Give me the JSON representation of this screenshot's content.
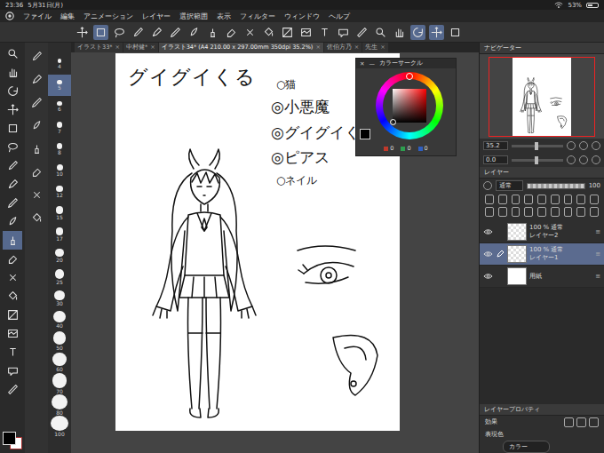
{
  "status_bar": {
    "time": "23:36",
    "date": "5月31日(月)",
    "battery": "53%",
    "battery_level": 0.53
  },
  "menu": [
    "ファイル",
    "編集",
    "アニメーション",
    "レイヤー",
    "選択範囲",
    "表示",
    "フィルター",
    "ウィンドウ",
    "ヘルプ"
  ],
  "command_bar": [
    {
      "selected": false
    },
    {
      "selected": true
    },
    {
      "selected": false
    },
    {
      "selected": false
    },
    {
      "selected": false
    },
    {
      "selected": false
    },
    {
      "selected": false
    },
    {
      "selected": false
    },
    {
      "selected": false
    },
    {
      "selected": false
    },
    {
      "selected": false
    },
    {
      "selected": false
    },
    {
      "selected": false
    },
    {
      "selected": false
    },
    {
      "selected": false
    },
    {
      "selected": false
    },
    {
      "selected": false
    },
    {
      "selected": false
    },
    {
      "selected": true
    },
    {
      "selected": true
    },
    {
      "selected": false
    }
  ],
  "tabs": [
    {
      "label": "イラスト33*",
      "selected": false
    },
    {
      "label": "中村健*",
      "selected": false
    },
    {
      "label": "イラスト34* (A4 210.00 x 297.00mm 350dpi 35.2%)",
      "selected": true
    },
    {
      "label": "佐伯方乃",
      "selected": false
    },
    {
      "label": "先生",
      "selected": false
    }
  ],
  "tab_close": "×",
  "tools": [
    {
      "selected": false
    },
    {
      "selected": false
    },
    {
      "selected": false
    },
    {
      "selected": false
    },
    {
      "selected": false
    },
    {
      "selected": false
    },
    {
      "selected": false
    },
    {
      "selected": false
    },
    {
      "selected": false
    },
    {
      "selected": false
    },
    {
      "selected": true
    },
    {
      "selected": false
    },
    {
      "selected": false
    },
    {
      "selected": false
    },
    {
      "selected": false
    },
    {
      "selected": false
    },
    {
      "selected": false
    },
    {
      "selected": false
    },
    {
      "selected": false
    }
  ],
  "sub_tools": [
    {
      "selected": false
    },
    {
      "selected": false
    },
    {
      "selected": false
    },
    {
      "selected": false
    },
    {
      "selected": false
    },
    {
      "selected": false
    },
    {
      "selected": false
    },
    {
      "selected": false
    }
  ],
  "brush_sizes": [
    {
      "label": "4",
      "selected": false
    },
    {
      "label": "5",
      "selected": true
    },
    {
      "label": "6",
      "selected": false
    },
    {
      "label": "7",
      "selected": false
    },
    {
      "label": "8",
      "selected": false
    },
    {
      "label": "10",
      "selected": false
    },
    {
      "label": "12",
      "selected": false
    },
    {
      "label": "15",
      "selected": false
    },
    {
      "label": "17",
      "selected": false
    },
    {
      "label": "20",
      "selected": false
    },
    {
      "label": "25",
      "selected": false
    },
    {
      "label": "30",
      "selected": false
    },
    {
      "label": "40",
      "selected": false
    },
    {
      "label": "50",
      "selected": false
    },
    {
      "label": "60",
      "selected": false
    },
    {
      "label": "70",
      "selected": false
    },
    {
      "label": "80",
      "selected": false
    },
    {
      "label": "100",
      "selected": false
    }
  ],
  "colors": {
    "main": "#000000",
    "sub": "#ffffff"
  },
  "canvas": {
    "title": "グイグイくる",
    "notes": [
      {
        "text": "○猫",
        "kind": "small"
      },
      {
        "text": "◎小悪魔",
        "kind": "large"
      },
      {
        "text": "◎グイグイくる",
        "kind": "large"
      },
      {
        "text": "◎ピアス",
        "kind": "large"
      },
      {
        "text": "○ネイル",
        "kind": "small"
      }
    ]
  },
  "color_circle": {
    "title": "カラーサークル",
    "close": "✕",
    "minimize": "—",
    "hue": "#ff0000",
    "color": "#000000",
    "channels": [
      {
        "value": "0",
        "color": "#c0392b"
      },
      {
        "value": "0",
        "color": "#2e9e4f"
      },
      {
        "value": "0",
        "color": "#2f5fc0"
      }
    ]
  },
  "navigator": {
    "title": "ナビゲーター"
  },
  "view": {
    "zoom": "35.2",
    "angle": "0.0"
  },
  "layers": {
    "title": "レイヤー",
    "blend": "通常",
    "opacity": "100",
    "opacity_level": 1,
    "items": [
      {
        "opacity": "100 %",
        "blend": "通常",
        "name": "レイヤー2",
        "selected": false,
        "visible": true,
        "kind": "raster"
      },
      {
        "opacity": "100 %",
        "blend": "通常",
        "name": "レイヤー1",
        "selected": true,
        "visible": true,
        "kind": "raster"
      },
      {
        "opacity": "",
        "blend": "",
        "name": "用紙",
        "selected": false,
        "visible": true,
        "kind": "paper"
      }
    ]
  },
  "layer_property": {
    "title": "レイヤープロパティ",
    "effect": "効果",
    "color_mode_label": "表現色",
    "color_mode": "カラー"
  }
}
